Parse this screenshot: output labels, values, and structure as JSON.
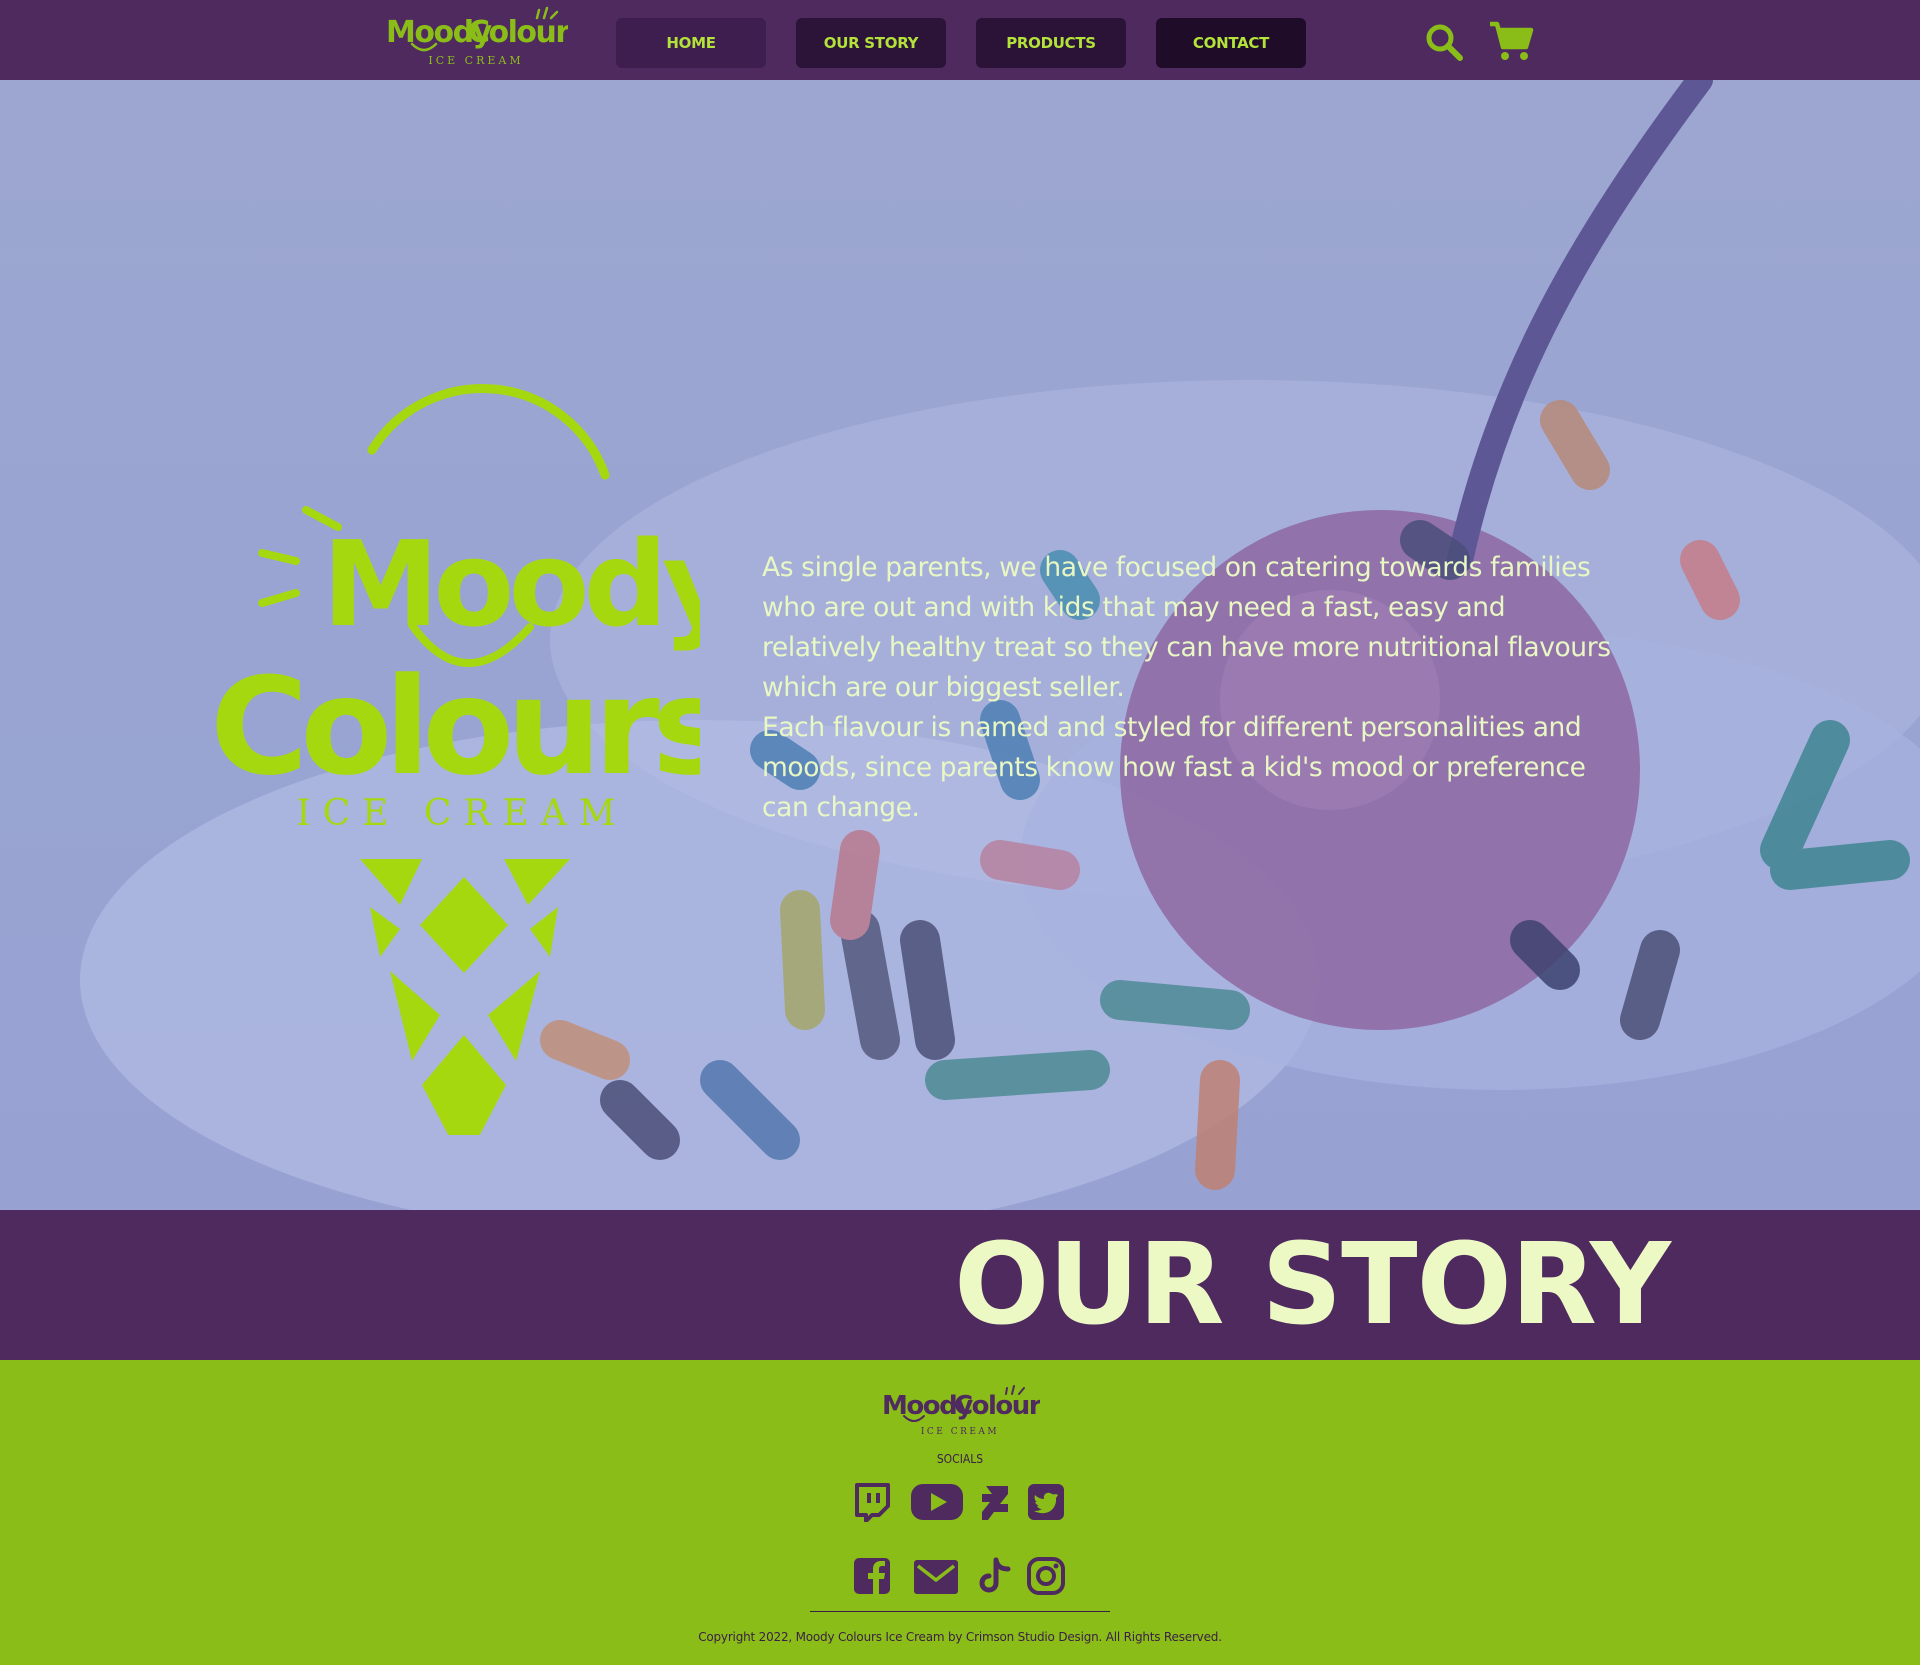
{
  "brand": {
    "name_line1": "Moody",
    "name_line2": "Colours",
    "tagline": "ICE CREAM",
    "accent_color": "#a6d810",
    "primary_color": "#4e2a5e"
  },
  "nav": {
    "items": [
      {
        "label": "HOME"
      },
      {
        "label": "OUR STORY"
      },
      {
        "label": "PRODUCTS"
      },
      {
        "label": "CONTACT"
      }
    ],
    "search_icon": "search-icon",
    "cart_icon": "cart-icon"
  },
  "hero": {
    "paragraph_1": "As single parents, we have focused on catering towards families who are out and with kids that may need a fast, easy and relatively healthy treat so they can have more nutritional flavours which are our biggest seller.",
    "paragraph_2": "Each flavour is named and styled for different personalities and moods, since parents know how fast a kid's mood or preference can change."
  },
  "story": {
    "title": "OUR STORY"
  },
  "footer": {
    "socials_label": "SOCIALS",
    "social_icons": [
      "twitch-icon",
      "youtube-icon",
      "deviantart-icon",
      "twitter-icon",
      "facebook-icon",
      "mail-icon",
      "tiktok-icon",
      "instagram-icon"
    ],
    "copyright": "Copyright 2022, Moody Colours Ice Cream by Crimson Studio Design. All Rights Reserved."
  }
}
